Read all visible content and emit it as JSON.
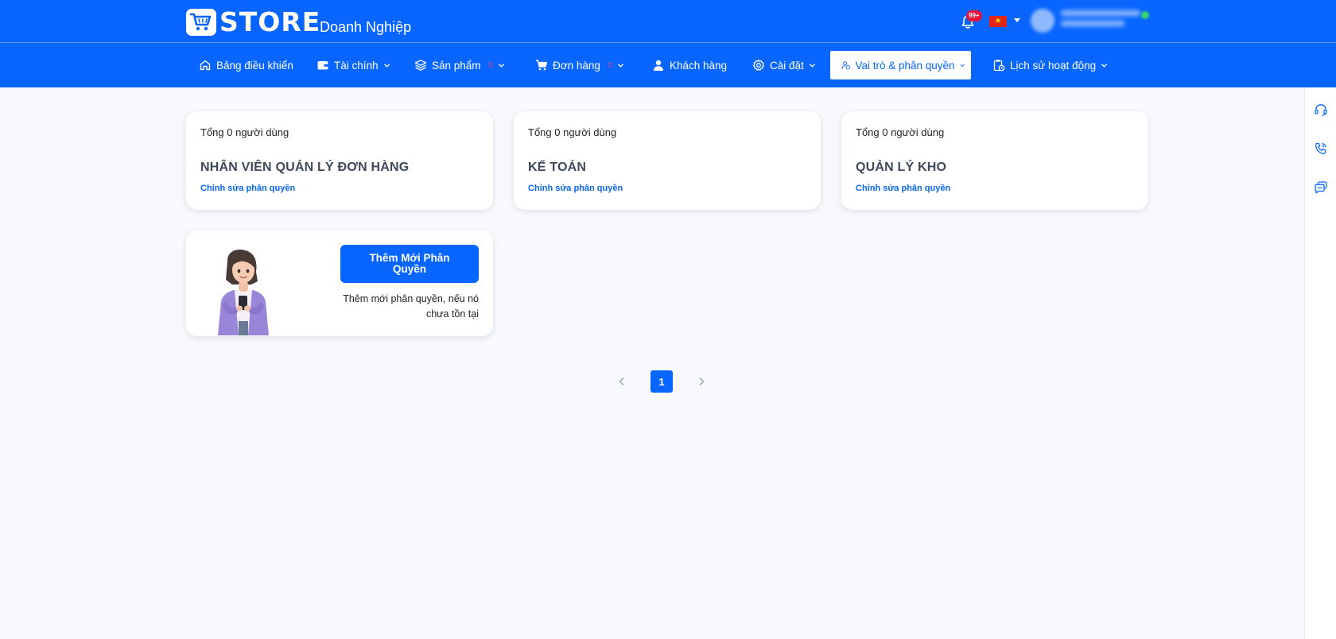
{
  "header": {
    "logo_text": "STORE",
    "brand_subtitle": "Doanh Nghiệp",
    "notification_badge": "99+",
    "flag_icon": "vietnam-flag-icon"
  },
  "nav": {
    "items": [
      {
        "label": "Bảng điều khiển",
        "icon": "home-icon"
      },
      {
        "label": "Tài chính",
        "icon": "wallet-icon"
      },
      {
        "label": "Sản phẩm",
        "icon": "layers-icon",
        "count": "0"
      },
      {
        "label": "Đơn hàng",
        "icon": "cart-icon",
        "count": "0"
      },
      {
        "label": "Khách hàng",
        "icon": "user-icon"
      },
      {
        "label": "Cài đặt",
        "icon": "gear-icon"
      },
      {
        "label": "Vai trò & phân quyền",
        "icon": "user-shield-icon",
        "active": true
      },
      {
        "label": "Lịch sử hoạt động",
        "icon": "clipboard-clock-icon"
      }
    ]
  },
  "roles": [
    {
      "total": "Tổng 0 người dùng",
      "name": "NHÂN VIÊN QUẢN LÝ ĐƠN HÀNG",
      "edit": "Chỉnh sửa phân quyền"
    },
    {
      "total": "Tổng 0 người dùng",
      "name": "KẾ TOÁN",
      "edit": "Chỉnh sửa phân quyền"
    },
    {
      "total": "Tổng 0 người dùng",
      "name": "QUẢN LÝ KHO",
      "edit": "Chỉnh sửa phân quyền"
    }
  ],
  "add_role": {
    "button_label": "Thêm Mới Phân Quyền",
    "description": "Thêm mới phân quyền, nếu nó chưa tồn tại"
  },
  "pagination": {
    "current_page": "1"
  },
  "side_rail": {
    "icons": [
      "headset-icon",
      "phone-call-icon",
      "chat-icon"
    ]
  },
  "colors": {
    "primary": "#0866ff",
    "background": "#f7f9fc",
    "badge": "#e8113a"
  }
}
